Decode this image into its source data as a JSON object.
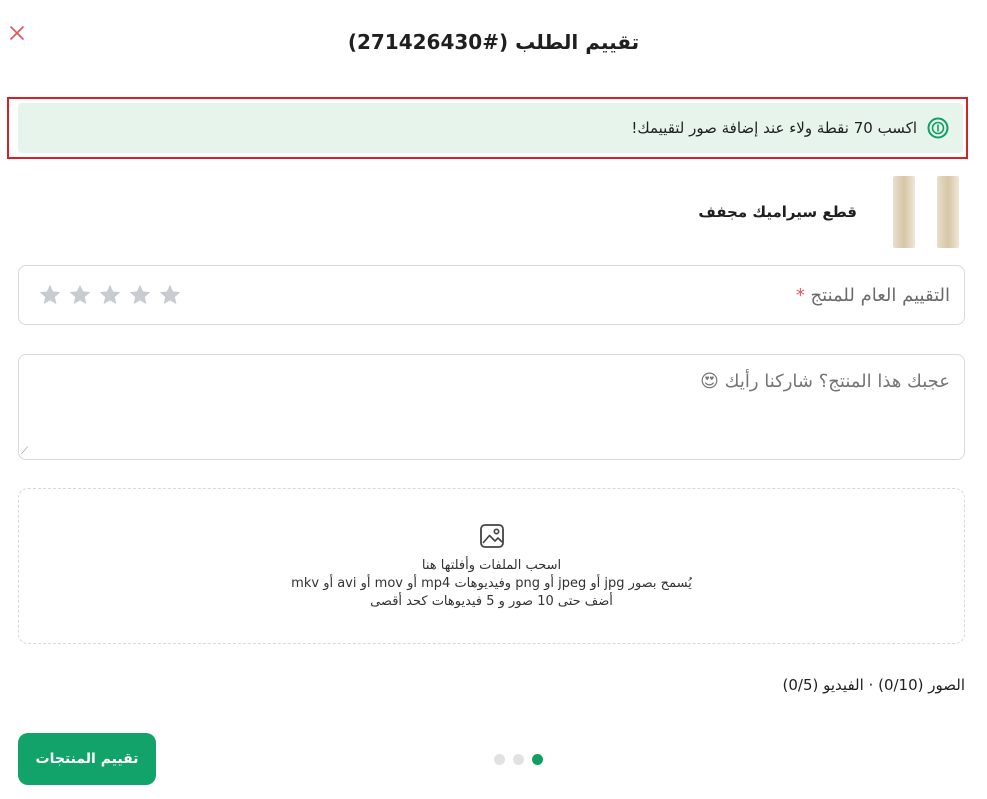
{
  "header": {
    "title": "تقييم الطلب (#271426430)",
    "close_icon": "close-icon"
  },
  "banner": {
    "icon": "loyalty-points-icon",
    "text": "اكسب 70 نقطة ولاء عند إضافة صور لتقييمك!"
  },
  "product": {
    "name": "قطع سيراميك مجفف"
  },
  "rating": {
    "label": "التقييم العام للمنتج",
    "required_mark": "*",
    "max_stars": 5,
    "selected": 0
  },
  "review": {
    "placeholder": "عجبك هذا المنتج؟ شاركنا رأيك 😍",
    "value": ""
  },
  "upload": {
    "icon": "image-icon",
    "line1": "اسحب الملفات وأفلتها هنا",
    "line2": "يُسمح بصور jpg أو jpeg أو png وفيديوهات mp4 أو mov أو avi أو mkv",
    "line3": "أضف حتى 10 صور و 5 فيديوهات كحد أقصى"
  },
  "counts": {
    "text": "الصور (0/10) · الفيديو (0/5)"
  },
  "footer": {
    "submit_label": "تقييم المنتجات"
  },
  "pagination": {
    "total": 3,
    "active_index": 0
  },
  "colors": {
    "accent": "#12a36a",
    "banner_bg": "#e7f4eb",
    "highlight_outline": "#d72027",
    "required": "#e0565b"
  }
}
